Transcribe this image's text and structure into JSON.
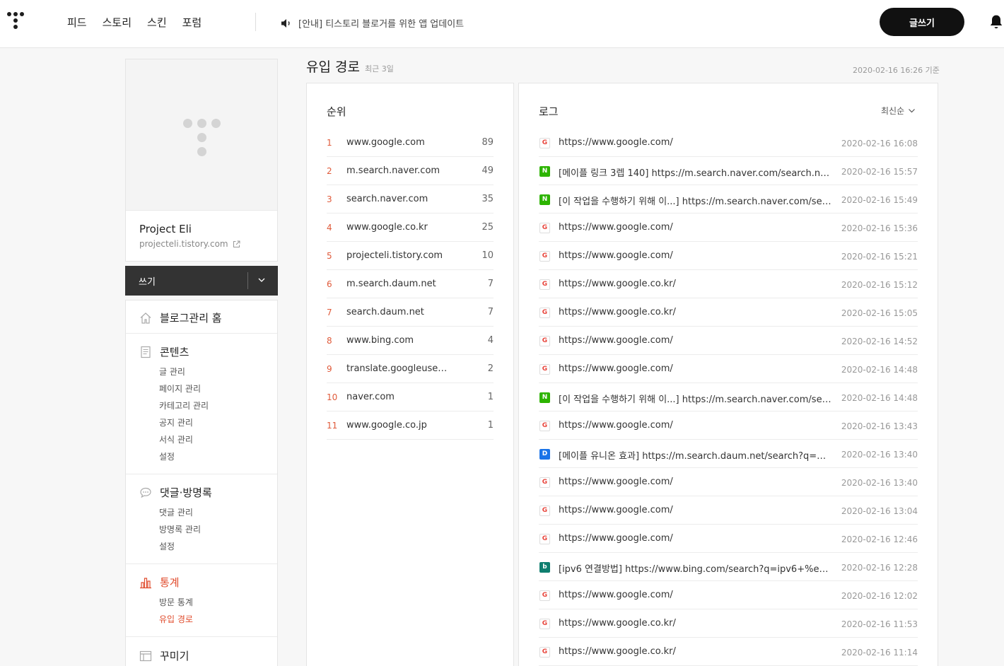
{
  "header": {
    "nav": [
      "피드",
      "스토리",
      "스킨",
      "포럼"
    ],
    "notice": "[안내] 티스토리 블로거를 위한 앱 업데이트",
    "write_label": "글쓰기"
  },
  "profile": {
    "name": "Project Eli",
    "url": "projecteli.tistory.com"
  },
  "write_bar": {
    "label": "쓰기"
  },
  "menu": {
    "home": "블로그관리 홈",
    "content": {
      "title": "콘텐츠",
      "items": [
        "글 관리",
        "페이지 관리",
        "카테고리 관리",
        "공지 관리",
        "서식 관리",
        "설정"
      ]
    },
    "comments": {
      "title": "댓글·방명록",
      "items": [
        "댓글 관리",
        "방명록 관리",
        "설정"
      ]
    },
    "stats": {
      "title": "통계",
      "items": [
        "방문 통계",
        "유입 경로"
      ]
    },
    "decorate": {
      "title": "꾸미기"
    }
  },
  "page": {
    "title": "유입 경로",
    "subtitle": "최근 3일",
    "timestamp": "2020-02-16 16:26 기준"
  },
  "ranking": {
    "title": "순위",
    "rows": [
      {
        "rank": "1",
        "host": "www.google.com",
        "count": "89"
      },
      {
        "rank": "2",
        "host": "m.search.naver.com",
        "count": "49"
      },
      {
        "rank": "3",
        "host": "search.naver.com",
        "count": "35"
      },
      {
        "rank": "4",
        "host": "www.google.co.kr",
        "count": "25"
      },
      {
        "rank": "5",
        "host": "projecteli.tistory.com",
        "count": "10"
      },
      {
        "rank": "6",
        "host": "m.search.daum.net",
        "count": "7"
      },
      {
        "rank": "7",
        "host": "search.daum.net",
        "count": "7"
      },
      {
        "rank": "8",
        "host": "www.bing.com",
        "count": "4"
      },
      {
        "rank": "9",
        "host": "translate.googleuse…",
        "count": "2"
      },
      {
        "rank": "10",
        "host": "naver.com",
        "count": "1"
      },
      {
        "rank": "11",
        "host": "www.google.co.jp",
        "count": "1"
      }
    ]
  },
  "log": {
    "title": "로그",
    "sort_label": "최신순",
    "rows": [
      {
        "badge": "G",
        "kind": "g",
        "url": "https://www.google.com/",
        "time": "2020-02-16 16:08"
      },
      {
        "badge": "N",
        "kind": "n",
        "url": "[메이플 링크 3렙 140] https://m.search.naver.com/search.naver?s…",
        "time": "2020-02-16 15:57"
      },
      {
        "badge": "N",
        "kind": "n",
        "url": "[이 작업을 수행하기 위해 이...] https://m.search.naver.com/search.…",
        "time": "2020-02-16 15:49"
      },
      {
        "badge": "G",
        "kind": "g",
        "url": "https://www.google.com/",
        "time": "2020-02-16 15:36"
      },
      {
        "badge": "G",
        "kind": "g",
        "url": "https://www.google.com/",
        "time": "2020-02-16 15:21"
      },
      {
        "badge": "G",
        "kind": "g",
        "url": "https://www.google.co.kr/",
        "time": "2020-02-16 15:12"
      },
      {
        "badge": "G",
        "kind": "g",
        "url": "https://www.google.co.kr/",
        "time": "2020-02-16 15:05"
      },
      {
        "badge": "G",
        "kind": "g",
        "url": "https://www.google.com/",
        "time": "2020-02-16 14:52"
      },
      {
        "badge": "G",
        "kind": "g",
        "url": "https://www.google.com/",
        "time": "2020-02-16 14:48"
      },
      {
        "badge": "N",
        "kind": "n",
        "url": "[이 작업을 수행하기 위해 이...] https://m.search.naver.com/search.…",
        "time": "2020-02-16 14:48"
      },
      {
        "badge": "G",
        "kind": "g",
        "url": "https://www.google.com/",
        "time": "2020-02-16 13:43"
      },
      {
        "badge": "D",
        "kind": "d",
        "url": "[메이플 유니온 효과] https://m.search.daum.net/search?q=%EB%…",
        "time": "2020-02-16 13:40"
      },
      {
        "badge": "G",
        "kind": "g",
        "url": "https://www.google.com/",
        "time": "2020-02-16 13:40"
      },
      {
        "badge": "G",
        "kind": "g",
        "url": "https://www.google.com/",
        "time": "2020-02-16 13:04"
      },
      {
        "badge": "G",
        "kind": "g",
        "url": "https://www.google.com/",
        "time": "2020-02-16 12:46"
      },
      {
        "badge": "b",
        "kind": "b",
        "url": "[ipv6 연결방법] https://www.bing.com/search?q=ipv6+%ec%97…",
        "time": "2020-02-16 12:28"
      },
      {
        "badge": "G",
        "kind": "g",
        "url": "https://www.google.com/",
        "time": "2020-02-16 12:02"
      },
      {
        "badge": "G",
        "kind": "g",
        "url": "https://www.google.co.kr/",
        "time": "2020-02-16 11:53"
      },
      {
        "badge": "G",
        "kind": "g",
        "url": "https://www.google.co.kr/",
        "time": "2020-02-16 11:14"
      }
    ]
  },
  "colors": {
    "accent": "#e04b2c",
    "header_button": "#111111",
    "write_bar": "#333333"
  }
}
